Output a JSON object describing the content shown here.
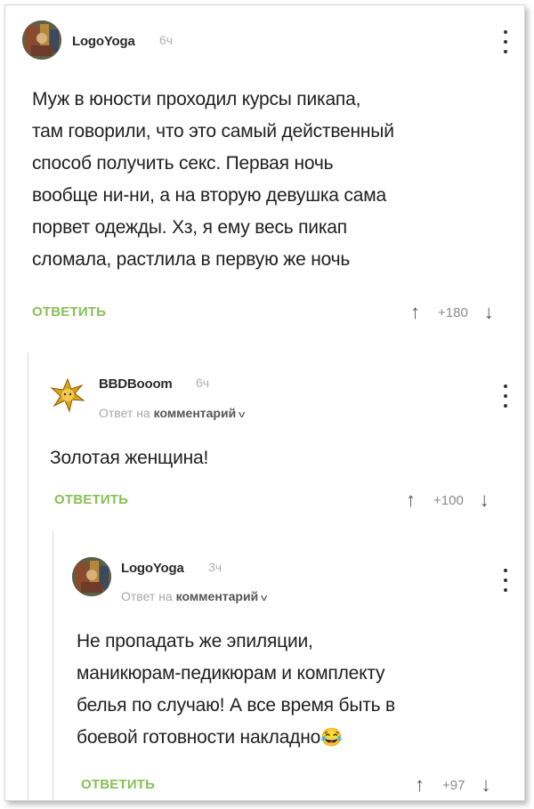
{
  "comments": [
    {
      "username": "LogoYoga",
      "time": "6ч",
      "text": "Муж в юности проходил курсы пикапа,\nтам говорили, что это самый действенный\nспособ получить секс. Первая ночь\nвообще ни-ни, а на вторую девушка сама\nпорвет одежды. Хз, я ему весь пикап\nсломала, растлила в первую же ночь",
      "reply_label": "ОТВЕТИТЬ",
      "rating": "+180"
    },
    {
      "username": "BBDBooom",
      "time": "6ч",
      "reply_prefix": "Ответ на",
      "reply_target": "комментарий",
      "text": "Золотая женщина!",
      "reply_label": "ОТВЕТИТЬ",
      "rating": "+100"
    },
    {
      "username": "LogoYoga",
      "time": "3ч",
      "reply_prefix": "Ответ на",
      "reply_target": "комментарий",
      "text": "Не пропадать же эпиляции,\nманикюрам-педикюрам и комплекту\nбелья по случаю! А все время быть в\nбоевой готовности накладно",
      "emoji": "😂",
      "reply_label": "ОТВЕТИТЬ",
      "rating": "+97"
    }
  ],
  "icons": {
    "upvote": "↑",
    "downvote": "↓",
    "chevron": "v"
  },
  "colors": {
    "reply_link": "#88c057",
    "muted": "#a8a8a8"
  }
}
